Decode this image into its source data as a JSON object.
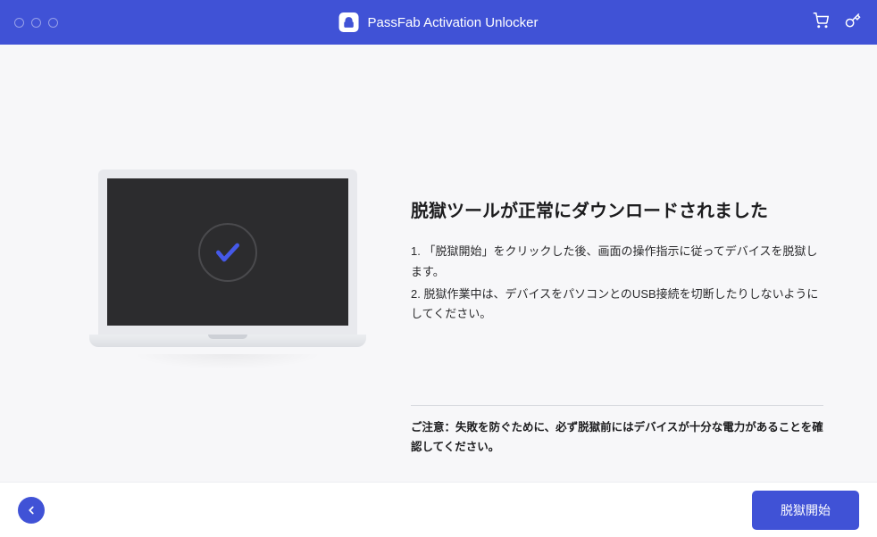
{
  "header": {
    "title": "PassFab Activation Unlocker"
  },
  "content": {
    "heading": "脱獄ツールが正常にダウンロードされました",
    "instruction1": "1. 「脱獄開始」をクリックした後、画面の操作指示に従ってデバイスを脱獄します。",
    "instruction2": "2. 脱獄作業中は、デバイスをパソコンとのUSB接続を切断したりしないようにしてください。",
    "notice": "ご注意：失敗を防ぐために、必ず脱獄前にはデバイスが十分な電力があることを確認してください。"
  },
  "footer": {
    "primary_button": "脱獄開始"
  }
}
